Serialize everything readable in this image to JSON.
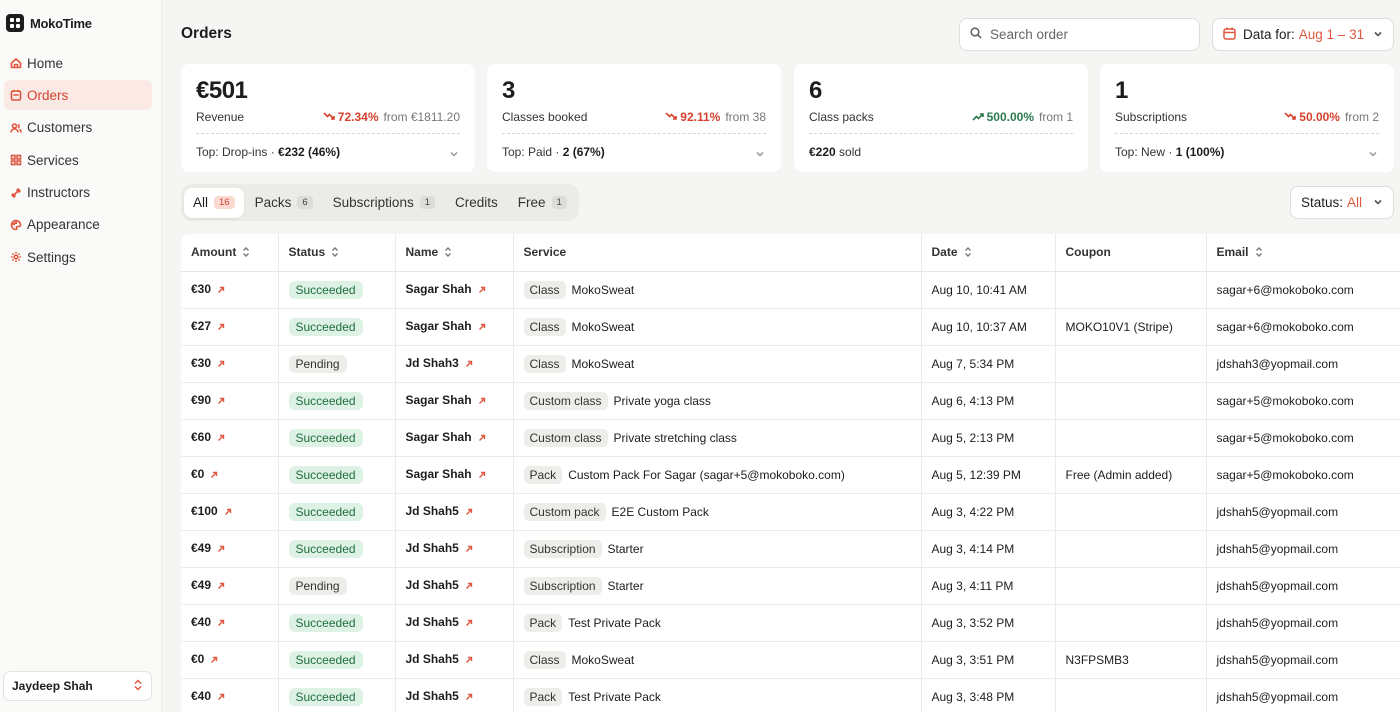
{
  "brand": {
    "name": "MokoTime"
  },
  "nav": [
    {
      "label": "Home",
      "icon": "home-icon",
      "active": false
    },
    {
      "label": "Orders",
      "icon": "orders-icon",
      "active": true
    },
    {
      "label": "Customers",
      "icon": "users-icon",
      "active": false
    },
    {
      "label": "Services",
      "icon": "grid-icon",
      "active": false
    },
    {
      "label": "Instructors",
      "icon": "dumbbell-icon",
      "active": false
    },
    {
      "label": "Appearance",
      "icon": "palette-icon",
      "active": false
    },
    {
      "label": "Settings",
      "icon": "gear-icon",
      "active": false
    }
  ],
  "user": {
    "name": "Jaydeep Shah"
  },
  "header": {
    "title": "Orders",
    "search_placeholder": "Search order",
    "date_label": "Data for:",
    "date_value": "Aug 1 – 31"
  },
  "cards": [
    {
      "value": "€501",
      "label": "Revenue",
      "direction": "down",
      "pct": "72.34%",
      "from": "from €1811.20",
      "foot_prefix": "Top: Drop-ins · ",
      "foot_bold": "€232 (46%)",
      "has_chevron": true
    },
    {
      "value": "3",
      "label": "Classes booked",
      "direction": "down",
      "pct": "92.11%",
      "from": "from 38",
      "foot_prefix": "Top: Paid · ",
      "foot_bold": "2 (67%)",
      "has_chevron": true
    },
    {
      "value": "6",
      "label": "Class packs",
      "direction": "up",
      "pct": "500.00%",
      "from": "from 1",
      "foot_prefix": "",
      "foot_bold": "€220",
      "foot_suffix": " sold",
      "has_chevron": false
    },
    {
      "value": "1",
      "label": "Subscriptions",
      "direction": "down",
      "pct": "50.00%",
      "from": "from 2",
      "foot_prefix": "Top: New · ",
      "foot_bold": "1 (100%)",
      "has_chevron": true
    }
  ],
  "tabs": [
    {
      "label": "All",
      "count": "16",
      "active": true
    },
    {
      "label": "Packs",
      "count": "6",
      "active": false
    },
    {
      "label": "Subscriptions",
      "count": "1",
      "active": false
    },
    {
      "label": "Credits",
      "count": "",
      "active": false
    },
    {
      "label": "Free",
      "count": "1",
      "active": false
    }
  ],
  "status_filter": {
    "label": "Status:",
    "value": "All"
  },
  "table": {
    "columns": [
      {
        "label": "Amount",
        "sortable": true
      },
      {
        "label": "Status",
        "sortable": true
      },
      {
        "label": "Name",
        "sortable": true
      },
      {
        "label": "Service",
        "sortable": false
      },
      {
        "label": "Date",
        "sortable": true
      },
      {
        "label": "Coupon",
        "sortable": false
      },
      {
        "label": "Email",
        "sortable": true
      }
    ],
    "rows": [
      {
        "amount": "€30",
        "status": "Succeeded",
        "name": "Sagar Shah",
        "service_type": "Class",
        "service_name": "MokoSweat",
        "date": "Aug 10, 10:41 AM",
        "coupon": "",
        "email": "sagar+6@mokoboko.com"
      },
      {
        "amount": "€27",
        "status": "Succeeded",
        "name": "Sagar Shah",
        "service_type": "Class",
        "service_name": "MokoSweat",
        "date": "Aug 10, 10:37 AM",
        "coupon": "MOKO10V1 (Stripe)",
        "email": "sagar+6@mokoboko.com"
      },
      {
        "amount": "€30",
        "status": "Pending",
        "name": "Jd Shah3",
        "service_type": "Class",
        "service_name": "MokoSweat",
        "date": "Aug 7, 5:34 PM",
        "coupon": "",
        "email": "jdshah3@yopmail.com"
      },
      {
        "amount": "€90",
        "status": "Succeeded",
        "name": "Sagar Shah",
        "service_type": "Custom class",
        "service_name": "Private yoga class",
        "date": "Aug 6, 4:13 PM",
        "coupon": "",
        "email": "sagar+5@mokoboko.com"
      },
      {
        "amount": "€60",
        "status": "Succeeded",
        "name": "Sagar Shah",
        "service_type": "Custom class",
        "service_name": "Private stretching class",
        "date": "Aug 5, 2:13 PM",
        "coupon": "",
        "email": "sagar+5@mokoboko.com"
      },
      {
        "amount": "€0",
        "status": "Succeeded",
        "name": "Sagar Shah",
        "service_type": "Pack",
        "service_name": "Custom Pack For Sagar (sagar+5@mokoboko.com)",
        "date": "Aug 5, 12:39 PM",
        "coupon": "Free (Admin added)",
        "email": "sagar+5@mokoboko.com"
      },
      {
        "amount": "€100",
        "status": "Succeeded",
        "name": "Jd Shah5",
        "service_type": "Custom pack",
        "service_name": "E2E Custom Pack",
        "date": "Aug 3, 4:22 PM",
        "coupon": "",
        "email": "jdshah5@yopmail.com"
      },
      {
        "amount": "€49",
        "status": "Succeeded",
        "name": "Jd Shah5",
        "service_type": "Subscription",
        "service_name": "Starter",
        "date": "Aug 3, 4:14 PM",
        "coupon": "",
        "email": "jdshah5@yopmail.com"
      },
      {
        "amount": "€49",
        "status": "Pending",
        "name": "Jd Shah5",
        "service_type": "Subscription",
        "service_name": "Starter",
        "date": "Aug 3, 4:11 PM",
        "coupon": "",
        "email": "jdshah5@yopmail.com"
      },
      {
        "amount": "€40",
        "status": "Succeeded",
        "name": "Jd Shah5",
        "service_type": "Pack",
        "service_name": "Test Private Pack",
        "date": "Aug 3, 3:52 PM",
        "coupon": "",
        "email": "jdshah5@yopmail.com"
      },
      {
        "amount": "€0",
        "status": "Succeeded",
        "name": "Jd Shah5",
        "service_type": "Class",
        "service_name": "MokoSweat",
        "date": "Aug 3, 3:51 PM",
        "coupon": "N3FPSMB3",
        "email": "jdshah5@yopmail.com"
      },
      {
        "amount": "€40",
        "status": "Succeeded",
        "name": "Jd Shah5",
        "service_type": "Pack",
        "service_name": "Test Private Pack",
        "date": "Aug 3, 3:48 PM",
        "coupon": "",
        "email": "jdshah5@yopmail.com"
      }
    ]
  },
  "colors": {
    "accent": "#e0573f",
    "down": "#d6422e",
    "up": "#2d7a4f",
    "success_bg": "#ddf2e4"
  }
}
